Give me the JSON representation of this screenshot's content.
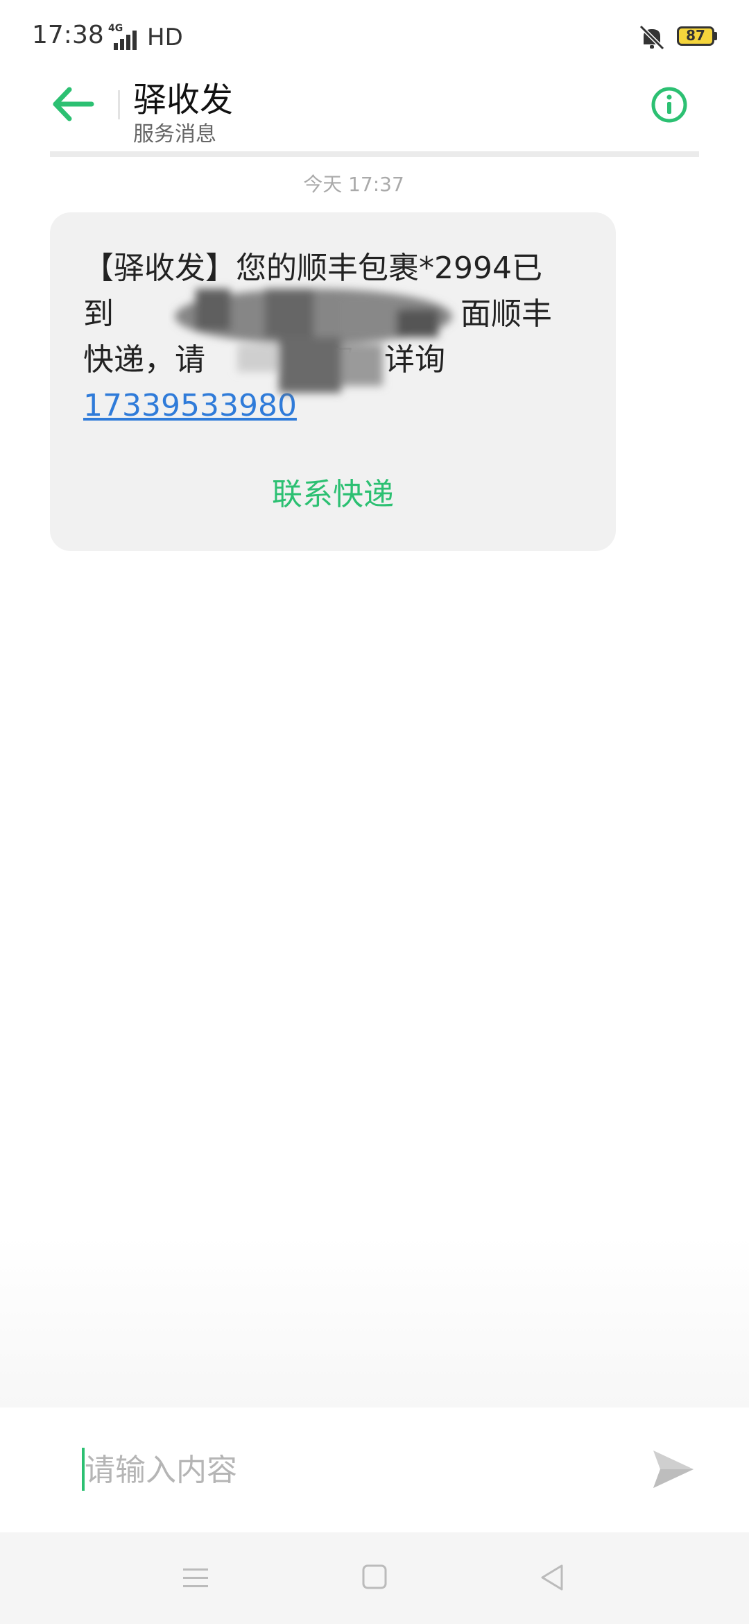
{
  "status_bar": {
    "time": "17:38",
    "network": "4G",
    "hd": "HD",
    "battery": "87",
    "battery_color": "#f5d53c",
    "icons": [
      "signal-icon",
      "mute-icon",
      "battery-icon"
    ]
  },
  "header": {
    "title": "驿收发",
    "subtitle": "服务消息",
    "accent": "#2cc072"
  },
  "conversation": {
    "timestamp": "今天 17:37",
    "message": {
      "line1": "【驿收发】您的顺丰包裹*2994已",
      "line2": "到",
      "line2_end": "面顺丰",
      "line3": "快递，请",
      "line3_end": "取，详询",
      "phone": "17339533980",
      "link_color": "#2f7bd9"
    },
    "action": "联系快递"
  },
  "input": {
    "placeholder": "请输入内容",
    "value": ""
  },
  "nav": {
    "icons": [
      "menu-icon",
      "home-icon",
      "back-icon"
    ]
  }
}
